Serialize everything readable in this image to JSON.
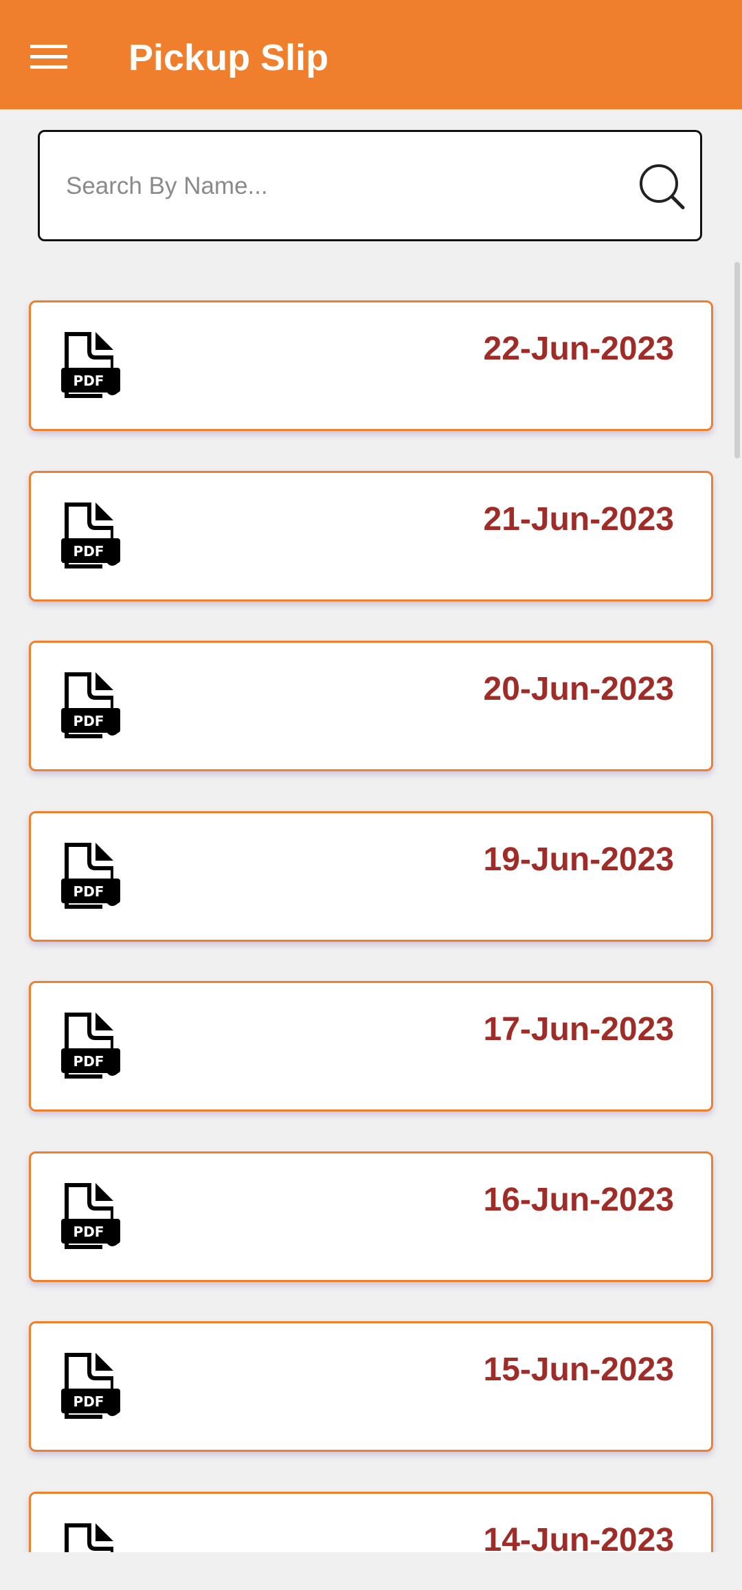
{
  "app_bar": {
    "title": "Pickup Slip",
    "menu_icon": "hamburger-menu-icon",
    "background_color": "#ef7f2c"
  },
  "search": {
    "placeholder": "Search By Name...",
    "value": "",
    "icon": "search-icon"
  },
  "slips": [
    {
      "date": "22-Jun-2023",
      "icon": "pdf-file-icon"
    },
    {
      "date": "21-Jun-2023",
      "icon": "pdf-file-icon"
    },
    {
      "date": "20-Jun-2023",
      "icon": "pdf-file-icon"
    },
    {
      "date": "19-Jun-2023",
      "icon": "pdf-file-icon"
    },
    {
      "date": "17-Jun-2023",
      "icon": "pdf-file-icon"
    },
    {
      "date": "16-Jun-2023",
      "icon": "pdf-file-icon"
    },
    {
      "date": "15-Jun-2023",
      "icon": "pdf-file-icon"
    },
    {
      "date": "14-Jun-2023",
      "icon": "pdf-file-icon"
    }
  ],
  "colors": {
    "accent": "#ef7f2c",
    "date_text": "#a02c28",
    "background": "#f0f0f0"
  }
}
